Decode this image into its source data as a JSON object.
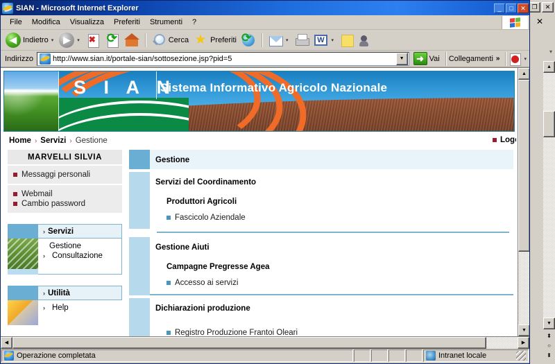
{
  "window": {
    "title": "SIAN - Microsoft Internet Explorer",
    "minimize_label": "_",
    "maximize_label": "□",
    "close_label": "✕",
    "outer_restore_label": "❐",
    "outer_close_label": "✕",
    "outer_close_x": "✕"
  },
  "menubar": {
    "items": [
      {
        "label": "File"
      },
      {
        "label": "Modifica"
      },
      {
        "label": "Visualizza"
      },
      {
        "label": "Preferiti"
      },
      {
        "label": "Strumenti"
      },
      {
        "label": "?"
      }
    ]
  },
  "toolbar": {
    "back_label": "Indietro",
    "back_caret": "▾",
    "forward_caret": "▾",
    "search_label": "Cerca",
    "favorites_label": "Preferiti",
    "mail_caret": "▾",
    "word_caret": "▾",
    "word_glyph": "W",
    "back_glyph": "◀",
    "forward_glyph": "▶"
  },
  "address": {
    "label": "Indirizzo",
    "url": "http://www.sian.it/portale-sian/sottosezione.jsp?pid=5",
    "dropdown_glyph": "▼",
    "go_label": "Vai",
    "go_glyph": "➜",
    "links_label": "Collegamenti",
    "links_chevron": "»",
    "acrobat_caret": "▾"
  },
  "banner": {
    "logo": "S I A N",
    "tagline": "Sistema Informativo Agricolo Nazionale"
  },
  "breadcrumb": {
    "home": "Home",
    "sep1": "›",
    "servizi": "Servizi",
    "sep2": "›",
    "current": "Gestione",
    "logout": "Logout"
  },
  "sidebar": {
    "user_name": "MARVELLI SILVIA",
    "personal": [
      {
        "label": "Messaggi personali"
      }
    ],
    "account": [
      {
        "label": "Webmail"
      },
      {
        "label": "Cambio password"
      }
    ],
    "servizi": {
      "title": "Servizi",
      "chevron": "›",
      "links": [
        {
          "label": "Gestione",
          "chevron": ""
        },
        {
          "label": "Consultazione",
          "chevron": "›"
        }
      ]
    },
    "utilita": {
      "title": "Utilità",
      "chevron": "›",
      "links": [
        {
          "label": "Help",
          "chevron": "›"
        }
      ]
    }
  },
  "main": {
    "page_title": "Gestione",
    "sections": [
      {
        "title": "Servizi del Coordinamento",
        "subtitle": "Produttori Agricoli",
        "items": [
          {
            "label": "Fascicolo Aziendale"
          }
        ]
      },
      {
        "title": "Gestione Aiuti",
        "subtitle": "Campagne Pregresse Agea",
        "items": [
          {
            "label": "Accesso ai servizi"
          }
        ]
      },
      {
        "title": "Dichiarazioni produzione",
        "subtitle": "",
        "items": [
          {
            "label": "Registro Produzione Frantoi Oleari"
          }
        ]
      }
    ]
  },
  "scrollbars": {
    "up_glyph": "▲",
    "down_glyph": "▼",
    "left_glyph": "◀",
    "right_glyph": "▶",
    "split_up_glyph": "⬍",
    "split_mid_glyph": "○",
    "split_dn_glyph": "⬍"
  },
  "statusbar": {
    "message": "Operazione completata",
    "zone": "Intranet locale"
  },
  "colors": {
    "title_blue": "#0a246a",
    "banner_blue": "#1a7fc0",
    "banner_orange": "#f06a28",
    "banner_green": "#0b8a45",
    "banner_soil": "#8a4c2e",
    "accent_teal": "#7fb2cc",
    "section_head": "#6aaed4",
    "section_bar": "#b6d9ec",
    "bullet_red": "#9b1b2e",
    "bullet_blue": "#4a96bb",
    "chrome_gray": "#d4d0c8"
  }
}
